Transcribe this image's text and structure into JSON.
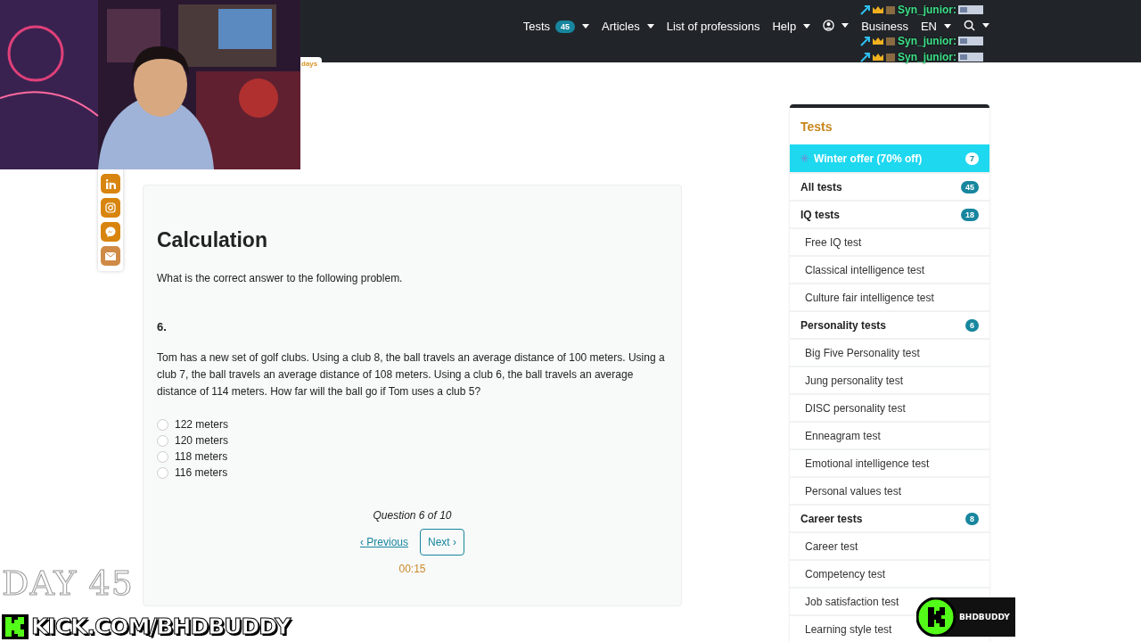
{
  "header": {
    "nav": [
      {
        "label": "Tests",
        "badge": "45",
        "caret": true
      },
      {
        "label": "Articles",
        "caret": true
      },
      {
        "label": "List of professions",
        "caret": false
      },
      {
        "label": "Help",
        "caret": true
      },
      {
        "kind": "user",
        "caret": true
      },
      {
        "label": "Business",
        "caret": false
      },
      {
        "label": "EN",
        "caret": true
      },
      {
        "kind": "search",
        "caret": true
      }
    ]
  },
  "promo_tag": "days",
  "share_bar": [
    {
      "kind": "linkedin"
    },
    {
      "kind": "instagram"
    },
    {
      "kind": "messenger"
    },
    {
      "kind": "mail"
    }
  ],
  "quiz": {
    "title": "Calculation",
    "instruction": "What is the correct answer to the following problem.",
    "number": "6.",
    "question": "Tom has a new set of golf clubs. Using a club 8, the ball travels an average distance of 100 meters. Using a club 7, the ball travels an average distance of 108 meters. Using a club 6, the ball travels an average distance of 114 meters. How far will the ball go if Tom uses a club 5?",
    "options": [
      {
        "label": "122 meters",
        "selected": false
      },
      {
        "label": "120 meters",
        "selected": false
      },
      {
        "label": "118 meters",
        "selected": false
      },
      {
        "label": "116 meters",
        "selected": false
      }
    ],
    "progress": "Question 6 of 10",
    "previous": "‹ Previous",
    "next": "Next ›",
    "timer": "00:15"
  },
  "sidebar": {
    "title": "Tests",
    "items": [
      {
        "kind": "offer",
        "label": "Winter offer (70% off)",
        "badge": "7"
      },
      {
        "kind": "category",
        "label": "All tests",
        "badge": "45"
      },
      {
        "kind": "category",
        "label": "IQ tests",
        "badge": "18"
      },
      {
        "kind": "item",
        "label": "Free IQ test"
      },
      {
        "kind": "item",
        "label": "Classical intelligence test"
      },
      {
        "kind": "item",
        "label": "Culture fair intelligence test"
      },
      {
        "kind": "category",
        "label": "Personality tests",
        "badge": "6"
      },
      {
        "kind": "item",
        "label": "Big Five Personality test"
      },
      {
        "kind": "item",
        "label": "Jung personality test"
      },
      {
        "kind": "item",
        "label": "DISC personality test"
      },
      {
        "kind": "item",
        "label": "Enneagram test"
      },
      {
        "kind": "item",
        "label": "Emotional intelligence test"
      },
      {
        "kind": "item",
        "label": "Personal values test"
      },
      {
        "kind": "category",
        "label": "Career tests",
        "badge": "8"
      },
      {
        "kind": "item",
        "label": "Career test"
      },
      {
        "kind": "item",
        "label": "Competency test"
      },
      {
        "kind": "item",
        "label": "Job satisfaction test"
      },
      {
        "kind": "item",
        "label": "Learning style test"
      }
    ]
  },
  "stream_overlay": {
    "chat": [
      {
        "user": "Syn_junior:"
      },
      {
        "user": "Syn_junior:"
      },
      {
        "user": "Syn_junior:"
      }
    ],
    "day_label": "DAY 45",
    "channel_url": "KICK.COM/BHDBUDDY",
    "channel_badge": "BHDBUDDY"
  }
}
